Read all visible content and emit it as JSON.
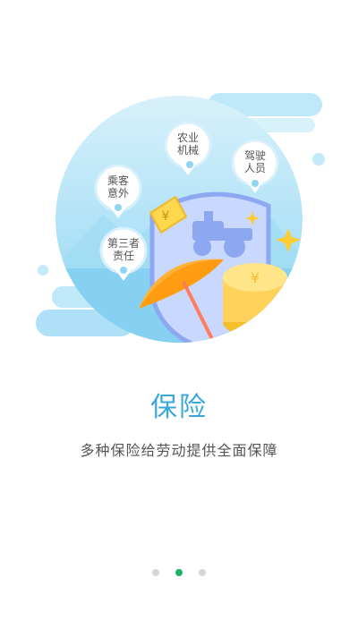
{
  "colors": {
    "accent_blue": "#3aa7db",
    "active_dot": "#19b26a",
    "inactive_dot": "#d6d6d6",
    "umbrella": "#ffa61f",
    "coin": "#ffd25a",
    "shield": "#c9d8ff"
  },
  "illustration": {
    "pins": {
      "agri_machinery": "农业\n机械",
      "passenger_accident": "乘客\n意外",
      "driver_personnel": "驾驶\n人员",
      "third_party": "第三者\n责任"
    },
    "icons": [
      "yuan-coin-icon",
      "tractor-icon",
      "umbrella-icon",
      "coin-stack-icon",
      "sparkle-icon"
    ]
  },
  "page": {
    "title": "保险",
    "subtitle": "多种保险给劳动提供全面保障"
  },
  "pager": {
    "count": 3,
    "active_index": 1
  }
}
